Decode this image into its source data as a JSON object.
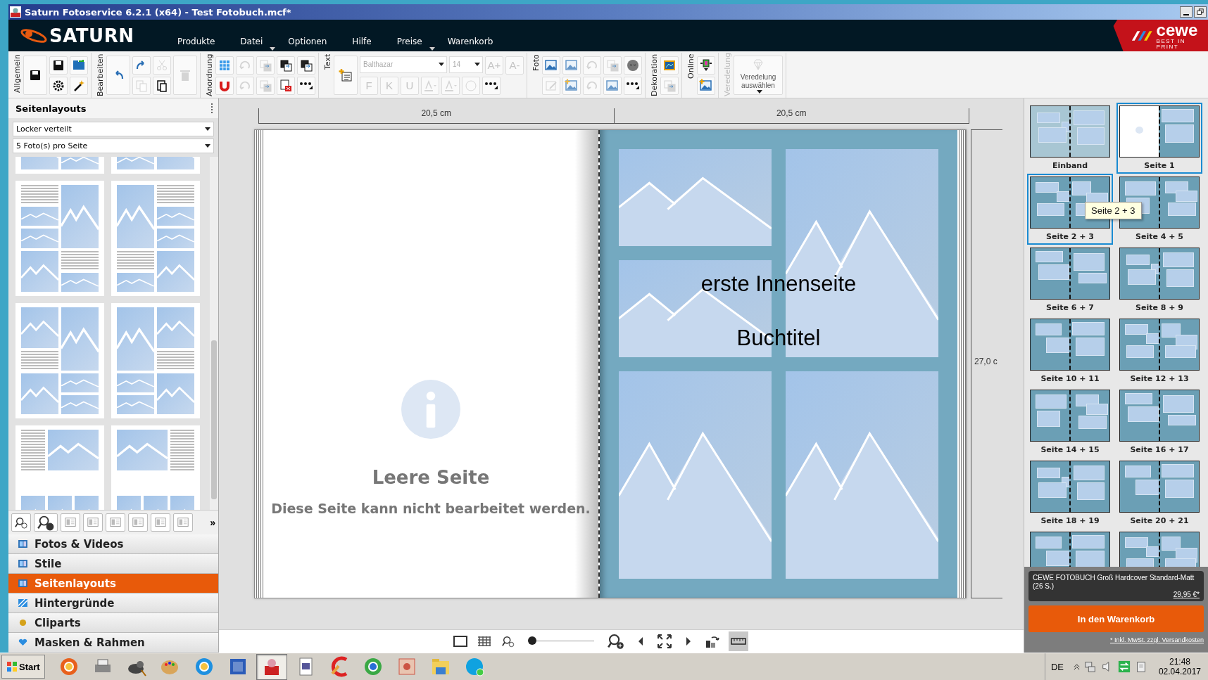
{
  "window": {
    "title": "Saturn Fotoservice 6.2.1 (x64) - Test Fotobuch.mcf*"
  },
  "header": {
    "logo": "SATURN",
    "brand": "cewe",
    "brand_tagline": "BEST IN PRINT",
    "menu": [
      {
        "label": "Produkte",
        "dropdown": false
      },
      {
        "label": "Datei",
        "dropdown": true
      },
      {
        "label": "Optionen",
        "dropdown": false
      },
      {
        "label": "Hilfe",
        "dropdown": false
      },
      {
        "label": "Preise",
        "dropdown": true
      },
      {
        "label": "Warenkorb",
        "dropdown": false
      }
    ]
  },
  "toolbar": {
    "groups": [
      {
        "label": "Allgemein",
        "disabled": false,
        "large": [
          {
            "disabled": false
          }
        ],
        "rows": [
          {
            "items": [
              {
                "kind": "icon",
                "disabled": false
              },
              {
                "kind": "icon",
                "disabled": false
              }
            ]
          },
          {
            "items": [
              {
                "kind": "icon",
                "disabled": false
              },
              {
                "kind": "icon",
                "disabled": false
              }
            ]
          }
        ]
      },
      {
        "label": "Bearbeiten",
        "disabled": false,
        "large": [
          {
            "disabled": false
          }
        ],
        "rows": [
          {
            "items": [
              {
                "kind": "icon",
                "disabled": false
              },
              {
                "kind": "icon",
                "disabled": true
              }
            ]
          },
          {
            "items": [
              {
                "kind": "icon",
                "disabled": true
              },
              {
                "kind": "icon",
                "disabled": false
              }
            ]
          }
        ],
        "trailing": [
          {
            "disabled": true
          }
        ]
      },
      {
        "label": "Anordnung",
        "disabled": false,
        "rows": [
          {
            "items": [
              {
                "kind": "icon",
                "disabled": false
              },
              {
                "kind": "icon",
                "disabled": true
              },
              {
                "kind": "icon",
                "disabled": true
              },
              {
                "kind": "icon",
                "disabled": false
              },
              {
                "kind": "icon",
                "disabled": false
              }
            ]
          },
          {
            "items": [
              {
                "kind": "icon",
                "disabled": false
              },
              {
                "kind": "icon",
                "disabled": true
              },
              {
                "kind": "icon",
                "disabled": true
              },
              {
                "kind": "icon",
                "disabled": false
              },
              {
                "kind": "icon",
                "disabled": false
              }
            ]
          }
        ]
      },
      {
        "label": "Text",
        "disabled": false,
        "large": [
          {
            "disabled": false
          }
        ],
        "rows": [
          {
            "items": [
              {
                "kind": "field",
                "value": "Balthazar",
                "disabled": true
              },
              {
                "kind": "field",
                "value": "14",
                "disabled": true
              },
              {
                "kind": "text",
                "label": "A+",
                "disabled": true
              },
              {
                "kind": "text",
                "label": "A-",
                "disabled": true
              }
            ]
          },
          {
            "items": [
              {
                "kind": "text",
                "label": "F",
                "disabled": true
              },
              {
                "kind": "text",
                "label": "K",
                "disabled": true
              },
              {
                "kind": "text",
                "label": "U",
                "disabled": true
              },
              {
                "kind": "icon",
                "disabled": true
              },
              {
                "kind": "icon",
                "disabled": true
              },
              {
                "kind": "icon",
                "disabled": true
              },
              {
                "kind": "icon",
                "disabled": false
              }
            ]
          }
        ]
      },
      {
        "label": "Foto",
        "disabled": false,
        "rows": [
          {
            "items": [
              {
                "kind": "icon",
                "disabled": false
              },
              {
                "kind": "icon",
                "disabled": true
              },
              {
                "kind": "icon",
                "disabled": true
              },
              {
                "kind": "icon",
                "disabled": true
              },
              {
                "kind": "icon",
                "disabled": false
              }
            ]
          },
          {
            "items": [
              {
                "kind": "icon",
                "disabled": true
              },
              {
                "kind": "icon",
                "disabled": true
              },
              {
                "kind": "icon",
                "disabled": true
              },
              {
                "kind": "icon",
                "disabled": true
              },
              {
                "kind": "icon",
                "disabled": false
              }
            ]
          }
        ]
      },
      {
        "label": "Dekoration",
        "disabled": false,
        "rows": [
          {
            "items": [
              {
                "kind": "icon",
                "disabled": false
              }
            ]
          },
          {
            "items": [
              {
                "kind": "icon",
                "disabled": true
              }
            ]
          }
        ]
      },
      {
        "label": "Online",
        "disabled": false,
        "rows": [
          {
            "items": [
              {
                "kind": "icon",
                "disabled": false
              }
            ]
          },
          {
            "items": [
              {
                "kind": "icon",
                "disabled": false
              }
            ]
          }
        ]
      },
      {
        "label": "Veredelung",
        "disabled": true,
        "large": [
          {
            "label": "Veredelung auswählen"
          }
        ]
      }
    ]
  },
  "sidebar": {
    "title": "Seitenlayouts",
    "filters": [
      {
        "value": "Locker verteilt"
      },
      {
        "value": "5 Foto(s) pro Seite"
      }
    ],
    "more_label": "»",
    "sections": [
      {
        "label": "Fotos & Videos",
        "selected": false
      },
      {
        "label": "Stile",
        "selected": false
      },
      {
        "label": "Seitenlayouts",
        "selected": true
      },
      {
        "label": "Hintergründe",
        "selected": false
      },
      {
        "label": "Cliparts",
        "selected": false
      },
      {
        "label": "Masken & Rahmen",
        "selected": false
      }
    ]
  },
  "canvas": {
    "ruler_left": "20,5 cm",
    "ruler_right": "20,5 cm",
    "ruler_height": "27,0 c",
    "left_page": {
      "title": "Leere Seite",
      "message": "Diese Seite kann nicht bearbeitet werden."
    },
    "right_page": {
      "texts": [
        "erste Innenseite",
        "Buchtitel"
      ]
    },
    "zoom": {
      "level": 0.05
    },
    "ruler_toggle": {
      "selected": true
    }
  },
  "pages_panel": {
    "thumbnails": [
      {
        "label": "Einband",
        "selected": false
      },
      {
        "label": "Seite 1",
        "selected": true
      },
      {
        "label": "Seite 2 + 3",
        "selected": true
      },
      {
        "label": "Seite 4 + 5",
        "selected": false
      },
      {
        "label": "Seite 6 + 7",
        "selected": false
      },
      {
        "label": "Seite 8 + 9",
        "selected": false
      },
      {
        "label": "Seite 10 + 11",
        "selected": false
      },
      {
        "label": "Seite 12 + 13",
        "selected": false
      },
      {
        "label": "Seite 14 + 15",
        "selected": false
      },
      {
        "label": "Seite 16 + 17",
        "selected": false
      },
      {
        "label": "Seite 18 + 19",
        "selected": false
      },
      {
        "label": "Seite 20 + 21",
        "selected": false
      }
    ],
    "partial_thumbnails": [
      {
        "selected": false
      },
      {
        "selected": false
      }
    ],
    "tooltip": "Seite 2 + 3",
    "cart": {
      "product": "CEWE FOTOBUCH Groß Hardcover Standard-Matt (26 S.)",
      "price": "29,95 €*",
      "button": "In den Warenkorb",
      "note": "* Inkl. MwSt. zzgl. Versandkosten"
    }
  },
  "taskbar": {
    "start": "Start",
    "apps": [
      {
        "selected": false
      },
      {
        "selected": false
      },
      {
        "selected": false
      },
      {
        "selected": false
      },
      {
        "selected": false
      },
      {
        "selected": false
      },
      {
        "selected": true
      },
      {
        "selected": false
      },
      {
        "selected": false
      },
      {
        "selected": false
      },
      {
        "selected": false
      },
      {
        "selected": false
      },
      {
        "selected": false
      }
    ],
    "language": "DE",
    "time": "21:48",
    "date": "02.04.2017"
  }
}
